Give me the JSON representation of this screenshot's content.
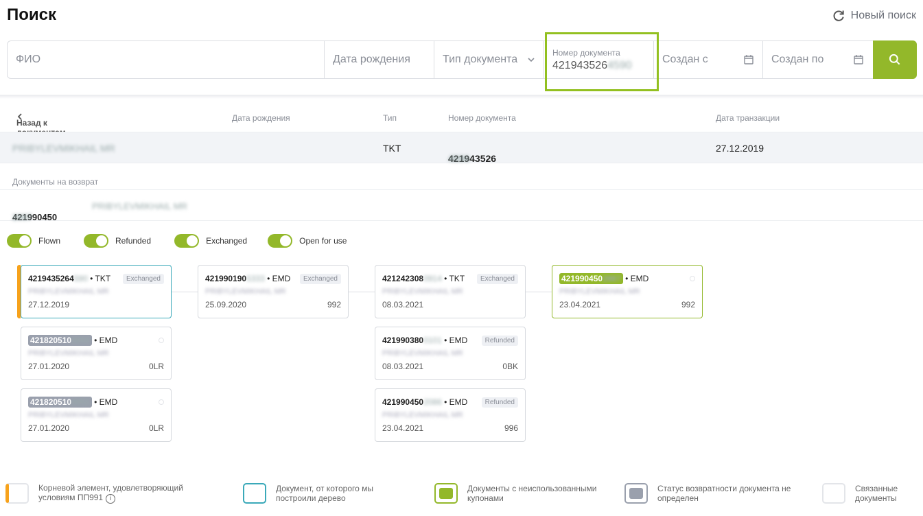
{
  "header": {
    "title": "Поиск",
    "new_search_label": "Новый поиск"
  },
  "search": {
    "fio_placeholder": "ФИО",
    "birth_placeholder": "Дата рождения",
    "doctype_placeholder": "Тип документа",
    "docnum_label": "Номер документа",
    "docnum_value": "421943526",
    "docnum_blur": "4590",
    "from_placeholder": "Создан с",
    "to_placeholder": "Создан по"
  },
  "table": {
    "back_label": "Назад к документам",
    "col_birth": "Дата рождения",
    "col_type": "Тип",
    "col_docnum": "Номер документа",
    "col_date": "Дата транзакции",
    "row_name": "PRIBYLEVMIKHAIL MR",
    "row_type": "TKT",
    "row_docnum": "421943526",
    "row_docnum_blur": "4590",
    "row_date": "27.12.2019"
  },
  "refund": {
    "label": "Документы на возврат",
    "num": "421990450",
    "num_blur": "2887",
    "name": "PRIBYLEVMIKHAIL MR"
  },
  "toggles": [
    {
      "label": "Flown",
      "on": true
    },
    {
      "label": "Refunded",
      "on": true
    },
    {
      "label": "Exchanged",
      "on": true
    },
    {
      "label": "Open for use",
      "on": true
    }
  ],
  "cards": [
    {
      "num": "4219435264",
      "blur": "590",
      "type": "• TKT",
      "badge": "Exchanged",
      "name": "PRIBYLEVMIKHAIL MR",
      "date": "27.12.2019",
      "amount": ""
    },
    {
      "num": "421820510",
      "blur": "0050",
      "type": "• EMD",
      "badge": "",
      "name": "PRIBYLEVMIKHAIL MR",
      "date": "27.01.2020",
      "amount": "0LR"
    },
    {
      "num": "421820510",
      "blur": "0051",
      "type": "• EMD",
      "badge": "",
      "name": "PRIBYLEVMIKHAIL MR",
      "date": "27.01.2020",
      "amount": "0LR"
    },
    {
      "num": "421990190",
      "blur": "5333",
      "type": "• EMD",
      "badge": "Exchanged",
      "name": "PRIBYLEVMIKHAIL MR",
      "date": "25.09.2020",
      "amount": "992"
    },
    {
      "num": "421242308",
      "blur": "0914",
      "type": "• TKT",
      "badge": "Exchanged",
      "name": "PRIBYLEVMIKHAIL MR",
      "date": "08.03.2021",
      "amount": ""
    },
    {
      "num": "421990380",
      "blur": "0101",
      "type": "• EMD",
      "badge": "Refunded",
      "name": "PRIBYLEVMIKHAIL MR",
      "date": "08.03.2021",
      "amount": "0BK"
    },
    {
      "num": "421990450",
      "blur": "2086",
      "type": "• EMD",
      "badge": "Refunded",
      "name": "PRIBYLEVMIKHAIL MR",
      "date": "23.04.2021",
      "amount": "996"
    },
    {
      "num": "421990450",
      "blur": "2887",
      "type": "• EMD",
      "badge": "",
      "name": "PRIBYLEVMIKHAIL MR",
      "date": "23.04.2021",
      "amount": "992"
    }
  ],
  "legend": [
    {
      "text": "Корневой элемент, удовлетворяющий условиям ПП991"
    },
    {
      "text": "Документ, от которого мы построили дерево"
    },
    {
      "text": "Документы с неиспользованными купонами"
    },
    {
      "text": "Статус возвратности документа не определен"
    },
    {
      "text": "Связанные документы"
    }
  ],
  "colors": {
    "accent": "#93b82a",
    "root": "#f7a21b",
    "selected": "#3aa9b9",
    "undefined": "#9aa0ad"
  }
}
